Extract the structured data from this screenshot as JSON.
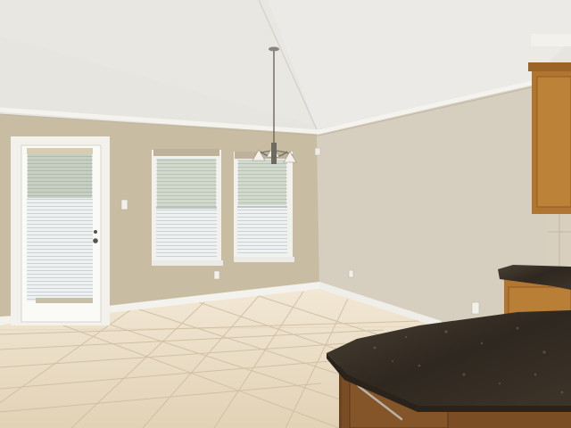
{
  "scene": {
    "colors": {
      "ceiling": "#e6e3dc",
      "wall_left": "#c9bda5",
      "wall_right": "#d8d1c2",
      "trim": "#f4f2ee",
      "floor_tile": "#e9dcc5",
      "grout": "#c9b79b",
      "cabinet_wood": "#b5782f",
      "granite": "#3a3228",
      "window_glass": "#dfe6e8"
    },
    "icons": [
      "chandelier-icon",
      "door-knob-icon",
      "cabinet-handle-icon",
      "outlet-icon",
      "light-switch-icon"
    ]
  }
}
